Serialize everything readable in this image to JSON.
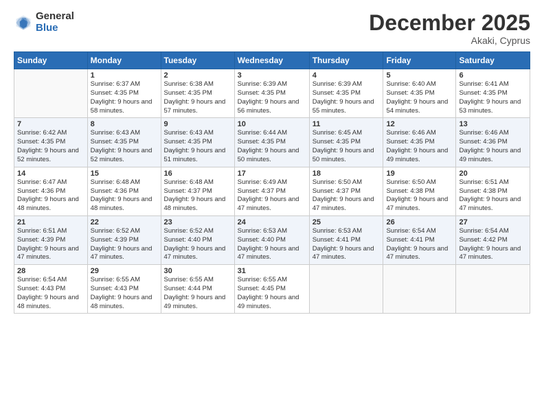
{
  "logo": {
    "general": "General",
    "blue": "Blue"
  },
  "header": {
    "month": "December 2025",
    "location": "Akaki, Cyprus"
  },
  "weekdays": [
    "Sunday",
    "Monday",
    "Tuesday",
    "Wednesday",
    "Thursday",
    "Friday",
    "Saturday"
  ],
  "weeks": [
    [
      {
        "day": "",
        "sunrise": "",
        "sunset": "",
        "daylight": ""
      },
      {
        "day": "1",
        "sunrise": "Sunrise: 6:37 AM",
        "sunset": "Sunset: 4:35 PM",
        "daylight": "Daylight: 9 hours and 58 minutes."
      },
      {
        "day": "2",
        "sunrise": "Sunrise: 6:38 AM",
        "sunset": "Sunset: 4:35 PM",
        "daylight": "Daylight: 9 hours and 57 minutes."
      },
      {
        "day": "3",
        "sunrise": "Sunrise: 6:39 AM",
        "sunset": "Sunset: 4:35 PM",
        "daylight": "Daylight: 9 hours and 56 minutes."
      },
      {
        "day": "4",
        "sunrise": "Sunrise: 6:39 AM",
        "sunset": "Sunset: 4:35 PM",
        "daylight": "Daylight: 9 hours and 55 minutes."
      },
      {
        "day": "5",
        "sunrise": "Sunrise: 6:40 AM",
        "sunset": "Sunset: 4:35 PM",
        "daylight": "Daylight: 9 hours and 54 minutes."
      },
      {
        "day": "6",
        "sunrise": "Sunrise: 6:41 AM",
        "sunset": "Sunset: 4:35 PM",
        "daylight": "Daylight: 9 hours and 53 minutes."
      }
    ],
    [
      {
        "day": "7",
        "sunrise": "Sunrise: 6:42 AM",
        "sunset": "Sunset: 4:35 PM",
        "daylight": "Daylight: 9 hours and 52 minutes."
      },
      {
        "day": "8",
        "sunrise": "Sunrise: 6:43 AM",
        "sunset": "Sunset: 4:35 PM",
        "daylight": "Daylight: 9 hours and 52 minutes."
      },
      {
        "day": "9",
        "sunrise": "Sunrise: 6:43 AM",
        "sunset": "Sunset: 4:35 PM",
        "daylight": "Daylight: 9 hours and 51 minutes."
      },
      {
        "day": "10",
        "sunrise": "Sunrise: 6:44 AM",
        "sunset": "Sunset: 4:35 PM",
        "daylight": "Daylight: 9 hours and 50 minutes."
      },
      {
        "day": "11",
        "sunrise": "Sunrise: 6:45 AM",
        "sunset": "Sunset: 4:35 PM",
        "daylight": "Daylight: 9 hours and 50 minutes."
      },
      {
        "day": "12",
        "sunrise": "Sunrise: 6:46 AM",
        "sunset": "Sunset: 4:35 PM",
        "daylight": "Daylight: 9 hours and 49 minutes."
      },
      {
        "day": "13",
        "sunrise": "Sunrise: 6:46 AM",
        "sunset": "Sunset: 4:36 PM",
        "daylight": "Daylight: 9 hours and 49 minutes."
      }
    ],
    [
      {
        "day": "14",
        "sunrise": "Sunrise: 6:47 AM",
        "sunset": "Sunset: 4:36 PM",
        "daylight": "Daylight: 9 hours and 48 minutes."
      },
      {
        "day": "15",
        "sunrise": "Sunrise: 6:48 AM",
        "sunset": "Sunset: 4:36 PM",
        "daylight": "Daylight: 9 hours and 48 minutes."
      },
      {
        "day": "16",
        "sunrise": "Sunrise: 6:48 AM",
        "sunset": "Sunset: 4:37 PM",
        "daylight": "Daylight: 9 hours and 48 minutes."
      },
      {
        "day": "17",
        "sunrise": "Sunrise: 6:49 AM",
        "sunset": "Sunset: 4:37 PM",
        "daylight": "Daylight: 9 hours and 47 minutes."
      },
      {
        "day": "18",
        "sunrise": "Sunrise: 6:50 AM",
        "sunset": "Sunset: 4:37 PM",
        "daylight": "Daylight: 9 hours and 47 minutes."
      },
      {
        "day": "19",
        "sunrise": "Sunrise: 6:50 AM",
        "sunset": "Sunset: 4:38 PM",
        "daylight": "Daylight: 9 hours and 47 minutes."
      },
      {
        "day": "20",
        "sunrise": "Sunrise: 6:51 AM",
        "sunset": "Sunset: 4:38 PM",
        "daylight": "Daylight: 9 hours and 47 minutes."
      }
    ],
    [
      {
        "day": "21",
        "sunrise": "Sunrise: 6:51 AM",
        "sunset": "Sunset: 4:39 PM",
        "daylight": "Daylight: 9 hours and 47 minutes."
      },
      {
        "day": "22",
        "sunrise": "Sunrise: 6:52 AM",
        "sunset": "Sunset: 4:39 PM",
        "daylight": "Daylight: 9 hours and 47 minutes."
      },
      {
        "day": "23",
        "sunrise": "Sunrise: 6:52 AM",
        "sunset": "Sunset: 4:40 PM",
        "daylight": "Daylight: 9 hours and 47 minutes."
      },
      {
        "day": "24",
        "sunrise": "Sunrise: 6:53 AM",
        "sunset": "Sunset: 4:40 PM",
        "daylight": "Daylight: 9 hours and 47 minutes."
      },
      {
        "day": "25",
        "sunrise": "Sunrise: 6:53 AM",
        "sunset": "Sunset: 4:41 PM",
        "daylight": "Daylight: 9 hours and 47 minutes."
      },
      {
        "day": "26",
        "sunrise": "Sunrise: 6:54 AM",
        "sunset": "Sunset: 4:41 PM",
        "daylight": "Daylight: 9 hours and 47 minutes."
      },
      {
        "day": "27",
        "sunrise": "Sunrise: 6:54 AM",
        "sunset": "Sunset: 4:42 PM",
        "daylight": "Daylight: 9 hours and 47 minutes."
      }
    ],
    [
      {
        "day": "28",
        "sunrise": "Sunrise: 6:54 AM",
        "sunset": "Sunset: 4:43 PM",
        "daylight": "Daylight: 9 hours and 48 minutes."
      },
      {
        "day": "29",
        "sunrise": "Sunrise: 6:55 AM",
        "sunset": "Sunset: 4:43 PM",
        "daylight": "Daylight: 9 hours and 48 minutes."
      },
      {
        "day": "30",
        "sunrise": "Sunrise: 6:55 AM",
        "sunset": "Sunset: 4:44 PM",
        "daylight": "Daylight: 9 hours and 49 minutes."
      },
      {
        "day": "31",
        "sunrise": "Sunrise: 6:55 AM",
        "sunset": "Sunset: 4:45 PM",
        "daylight": "Daylight: 9 hours and 49 minutes."
      },
      {
        "day": "",
        "sunrise": "",
        "sunset": "",
        "daylight": ""
      },
      {
        "day": "",
        "sunrise": "",
        "sunset": "",
        "daylight": ""
      },
      {
        "day": "",
        "sunrise": "",
        "sunset": "",
        "daylight": ""
      }
    ]
  ]
}
